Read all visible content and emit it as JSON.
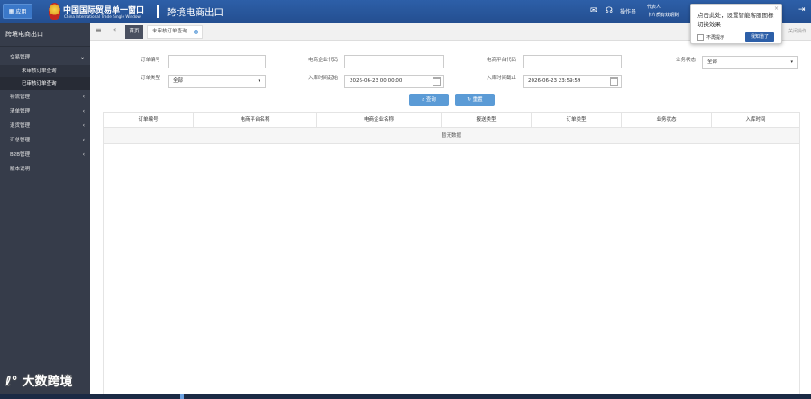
{
  "header": {
    "app_button": "应用",
    "logo_cn": "中国国际贸易单一窗口",
    "logo_en": "China International Trade Single Window",
    "system_title": "跨境电商出口",
    "ops_label": "操作员",
    "user_line1": "代表人",
    "user_line2": "卡介质有效期剩"
  },
  "sidebar": {
    "title": "跨境电商出口",
    "groups": [
      {
        "label": "交易管理",
        "expanded": true,
        "children": [
          "未审核订单查询",
          "已审核订单查询"
        ]
      },
      {
        "label": "物流管理"
      },
      {
        "label": "清单管理"
      },
      {
        "label": "退货管理"
      },
      {
        "label": "汇总管理"
      },
      {
        "label": "B2B管理"
      },
      {
        "label": "版本说明"
      }
    ]
  },
  "tabs": {
    "home": "首页",
    "active": "未审核订单查询",
    "close_ops": "关闭操作"
  },
  "form": {
    "order_no_label": "订单编号",
    "order_no_value": "",
    "ecom_code_label": "电商企业代码",
    "ecom_code_value": "",
    "platform_code_label": "电商平台代码",
    "platform_code_value": "",
    "biz_status_label": "业务状态",
    "biz_status_value": "全部",
    "order_type_label": "订单类型",
    "order_type_value": "全部",
    "start_label": "入库时间起始",
    "start_value": "2026-06-23 00:00:00",
    "end_label": "入库时间截止",
    "end_value": "2026-06-23 23:59:59",
    "search_btn": "查询",
    "reset_btn": "重置"
  },
  "table": {
    "columns": [
      "订单编号",
      "电商平台名称",
      "电商企业名称",
      "报送类型",
      "订单类型",
      "业务状态",
      "入库时间"
    ],
    "empty_text": "暂无数据"
  },
  "popup": {
    "text": "点击此处，设置智能客服图标切换效果",
    "no_more": "不再提示",
    "ok": "我知道了"
  },
  "watermark": "大数跨境"
}
